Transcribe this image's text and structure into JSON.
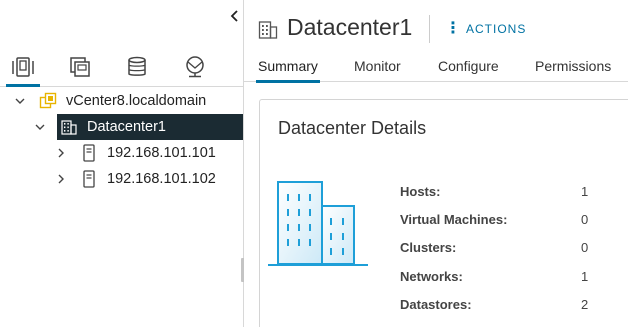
{
  "navigator": {
    "collapse_glyph": "‹",
    "tabs": [
      {
        "name": "hosts-and-clusters",
        "icon": "hosts-clusters-icon",
        "active": true
      },
      {
        "name": "vms-and-templates",
        "icon": "vms-templates-icon",
        "active": false
      },
      {
        "name": "storage",
        "icon": "storage-icon",
        "active": false
      },
      {
        "name": "networking",
        "icon": "networking-icon",
        "active": false
      }
    ],
    "tree": [
      {
        "label": "vCenter8.localdomain",
        "icon": "vcenter-icon",
        "expanded": true,
        "level": 0
      },
      {
        "label": "Datacenter1",
        "icon": "datacenter-icon",
        "expanded": true,
        "level": 1,
        "selected": true
      },
      {
        "label": "192.168.101.101",
        "icon": "host-icon",
        "expanded": false,
        "level": 2
      },
      {
        "label": "192.168.101.102",
        "icon": "host-icon",
        "expanded": false,
        "level": 2
      }
    ]
  },
  "header": {
    "title": "Datacenter1",
    "actions_label": "ACTIONS"
  },
  "tabs": [
    {
      "label": "Summary",
      "active": true
    },
    {
      "label": "Monitor",
      "active": false
    },
    {
      "label": "Configure",
      "active": false
    },
    {
      "label": "Permissions",
      "active": false
    }
  ],
  "details_card": {
    "title": "Datacenter Details",
    "rows": [
      {
        "label": "Hosts:",
        "value": "1"
      },
      {
        "label": "Virtual Machines:",
        "value": "0"
      },
      {
        "label": "Clusters:",
        "value": "0"
      },
      {
        "label": "Networks:",
        "value": "1"
      },
      {
        "label": "Datastores:",
        "value": "2"
      }
    ]
  },
  "colors": {
    "accent": "#0072a3",
    "selected_row_bg": "#1b2b33",
    "illustration": "#1e9fd8",
    "vcenter_icon": "#e8b400"
  }
}
